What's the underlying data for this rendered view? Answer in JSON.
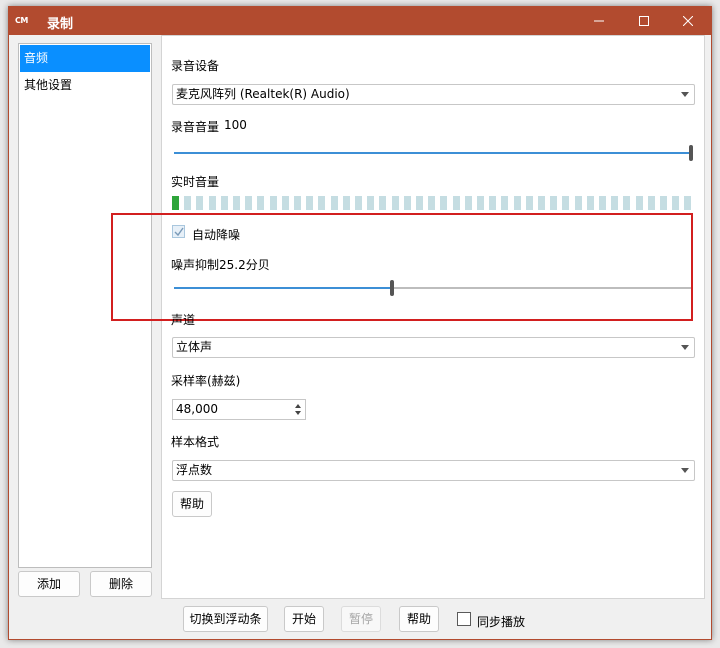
{
  "window": {
    "title": "录制",
    "app_icon_text": "CM",
    "accent_color": "#b24b2f"
  },
  "sidebar": {
    "items": [
      {
        "label": "音频",
        "active": true
      },
      {
        "label": "其他设置",
        "active": false
      }
    ],
    "add_label": "添加",
    "delete_label": "删除"
  },
  "audio": {
    "device_label": "录音设备",
    "device_value": "麦克风阵列 (Realtek(R) Audio)",
    "volume_label": "录音音量",
    "volume_value": "100",
    "volume_level": 1.0,
    "live_level_label": "实时音量",
    "live_level_active_segments": 1,
    "noise_reduction_label": "自动降噪",
    "noise_reduction_checked": true,
    "noise_suppress_label": "噪声抑制25.2分贝",
    "noise_suppress_level": 0.42,
    "channel_label": "声道",
    "channel_value": "立体声",
    "sample_rate_label": "采样率(赫兹)",
    "sample_rate_value": "48,000",
    "sample_format_label": "样本格式",
    "sample_format_value": "浮点数",
    "help_label": "帮助"
  },
  "footer": {
    "float_label": "切换到浮动条",
    "start_label": "开始",
    "pause_label": "暂停",
    "help_label": "帮助",
    "sync_label": "同步播放",
    "sync_checked": false
  }
}
